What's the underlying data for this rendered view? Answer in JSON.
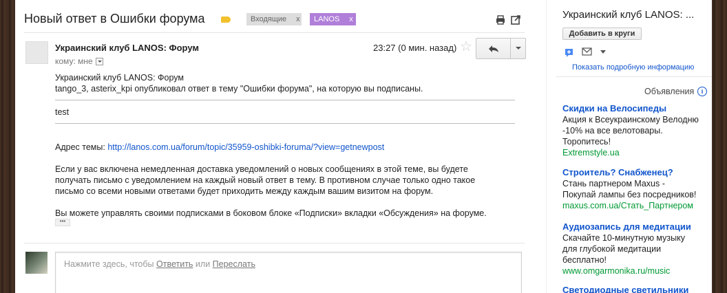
{
  "header": {
    "subject": "Новый ответ в Ошибки форума",
    "labels": [
      {
        "name": "Входящие",
        "remove": "x"
      },
      {
        "name": "LANOS",
        "remove": "x"
      }
    ]
  },
  "message": {
    "sender": "Украинский клуб LANOS: Форум",
    "to_line": "кому: мне",
    "time": "23:27 (0 мин. назад)",
    "star": "☆",
    "body": {
      "line1": "Украинский клуб LANOS: Форум",
      "line2": "tango_3, asterix_kpi опубликовал ответ в тему \"Ошибки форума\", на которую вы подписаны.",
      "post_text": "test",
      "address_label": "Адрес темы: ",
      "address_url": "http://lanos.com.ua/forum/topic/35959-oshibki-foruma/?view=getnewpost",
      "para1_l1": "Если у вас включена немедленная доставка уведомлений о новых сообщениях в этой теме, вы будете",
      "para1_l2": "получать письмо с уведомлением на каждый новый ответ в тему. В противном случае только одно такое",
      "para1_l3": "письмо со всеми новыми ответами будет приходить между каждым вашим визитом на форум.",
      "para2": "Вы можете управлять своими подписками в боковом блоке «Подписки» вкладки «Обсуждения» на форуме.",
      "ellipsis": "•••"
    }
  },
  "reply_box": {
    "prompt": "Нажмите здесь, чтобы ",
    "reply_link": "Ответить",
    "or": " или ",
    "forward_link": "Переслать"
  },
  "right_panel": {
    "name": "Украинский клуб LANOS: ...",
    "add_circles": "Добавить в круги",
    "show_details": "Показать подробную информацию",
    "ads_heading": "Объявления",
    "info": "i",
    "ads": [
      {
        "title": "Скидки на Велосипеды",
        "text_l1": "Акция к Всеукраинскому Велодню",
        "text_l2": "-10% на все велотовары.",
        "text_l3": "Торопитесь!",
        "url": "Extremstyle.ua"
      },
      {
        "title": "Строитель? Снабженец?",
        "text_l1": "Стань партнером Maxus -",
        "text_l2": "Покупай лампы без посредников!",
        "text_l3": "",
        "url": "maxus.com.ua/Стать_Партнером"
      },
      {
        "title": "Аудиозапись для медитации",
        "text_l1": "Скачайте 10-минутную музыку",
        "text_l2": "для глубокой медитации",
        "text_l3": "бесплатно!",
        "url": "www.omgarmonika.ru/music"
      },
      {
        "title": "Светодиодные светильники",
        "text_l1": "",
        "text_l2": "",
        "text_l3": "",
        "url": ""
      }
    ]
  },
  "colors": {
    "link": "#1155cc",
    "ad_url": "#009933",
    "label_lanos": "#b07fd9",
    "label_inbox": "#dddddd",
    "important_tag": "#f2c12e"
  }
}
